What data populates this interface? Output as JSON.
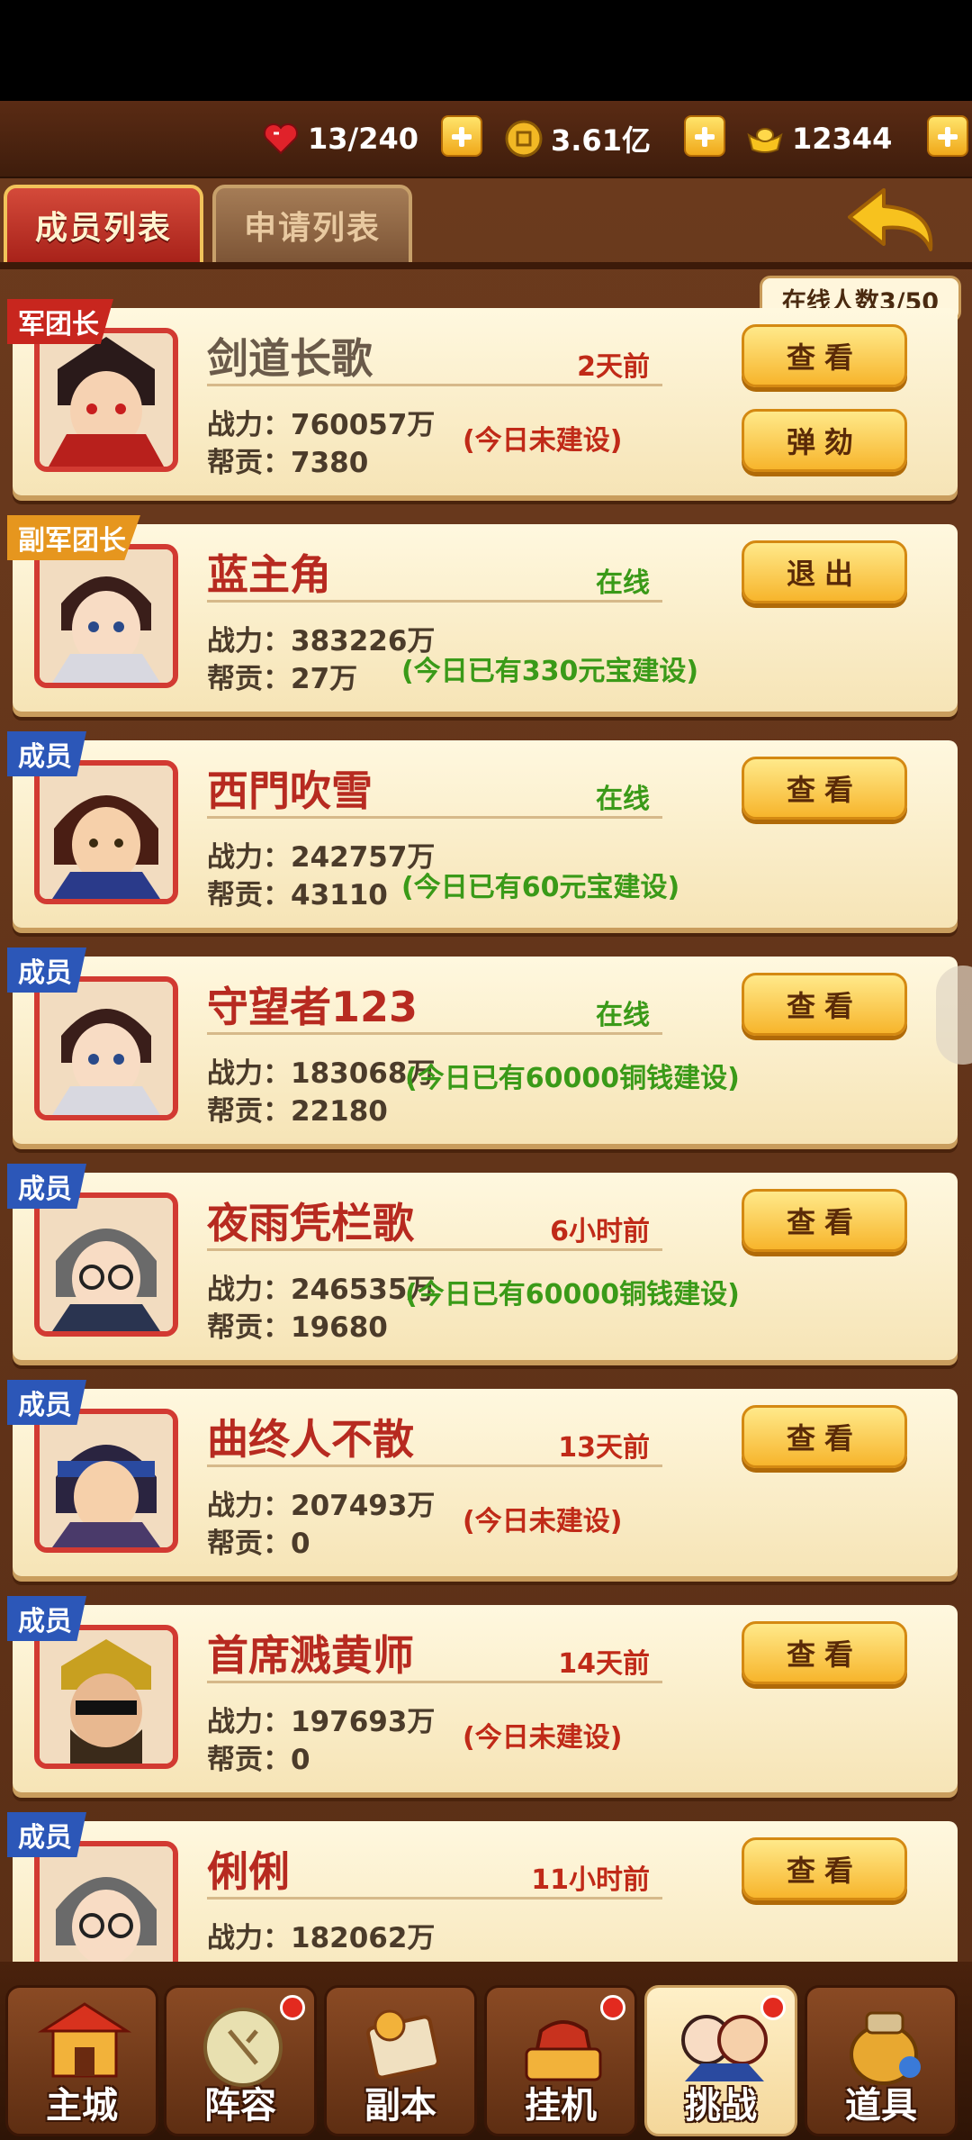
{
  "resources": {
    "stamina": "13/240",
    "coins": "3.61亿",
    "ingots": "12344"
  },
  "tabs": {
    "members": "成员列表",
    "applications": "申请列表"
  },
  "online_count": "在线人数3/50",
  "members": [
    {
      "role": "军团长",
      "name": "剑道长歌",
      "status": "2天前",
      "power": "战力：760057万",
      "contrib": "帮贡：7380",
      "note": "(今日未建设)",
      "btn1": "查看",
      "btn2": "弹劾"
    },
    {
      "role": "副军团长",
      "name": "蓝主角",
      "status": "在线",
      "power": "战力：383226万",
      "contrib": "帮贡：27万",
      "note": "(今日已有330元宝建设)",
      "btn1": "退出"
    },
    {
      "role": "成员",
      "name": "西門吹雪",
      "status": "在线",
      "power": "战力：242757万",
      "contrib": "帮贡：43110",
      "note": "(今日已有60元宝建设)",
      "btn1": "查看"
    },
    {
      "role": "成员",
      "name": "守望者123",
      "status": "在线",
      "power": "战力：183068万",
      "contrib": "帮贡：22180",
      "note": "(今日已有60000铜钱建设)",
      "btn1": "查看"
    },
    {
      "role": "成员",
      "name": "夜雨凭栏歌",
      "status": "6小时前",
      "power": "战力：246535万",
      "contrib": "帮贡：19680",
      "note": "(今日已有60000铜钱建设)",
      "btn1": "查看"
    },
    {
      "role": "成员",
      "name": "曲终人不散",
      "status": "13天前",
      "power": "战力：207493万",
      "contrib": "帮贡：0",
      "note": "(今日未建设)",
      "btn1": "查看"
    },
    {
      "role": "成员",
      "name": "首席溅黄师",
      "status": "14天前",
      "power": "战力：197693万",
      "contrib": "帮贡：0",
      "note": "(今日未建设)",
      "btn1": "查看"
    },
    {
      "role": "成员",
      "name": "俐俐",
      "status": "11小时前",
      "power": "战力：182062万",
      "btn1": "查看"
    }
  ],
  "nav": [
    "主城",
    "阵容",
    "副本",
    "挂机",
    "挑战",
    "道具"
  ],
  "colors": {
    "accent_red": "#b72a20",
    "online_green": "#3a9a18",
    "button_gold": "#f7b52c"
  }
}
